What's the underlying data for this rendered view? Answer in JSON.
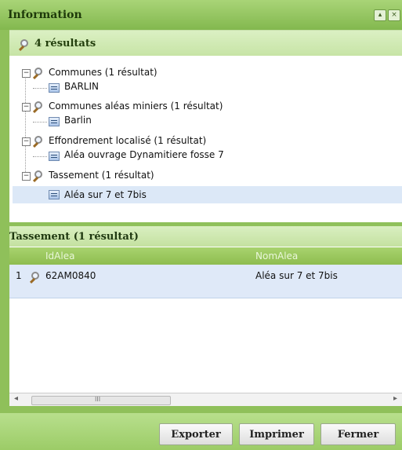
{
  "window": {
    "title": "Information",
    "controls": [
      "▴",
      "×"
    ]
  },
  "results": {
    "count_label": "4 résultats",
    "tree": [
      {
        "group": "Communes (1 résultat)",
        "item": "BARLIN"
      },
      {
        "group": "Communes aléas miniers (1 résultat)",
        "item": "Barlin"
      },
      {
        "group": "Effondrement localisé (1 résultat)",
        "item": "Aléa ouvrage Dynamitiere fosse 7"
      },
      {
        "group": "Tassement (1 résultat)",
        "item": "Aléa sur 7 et 7bis"
      }
    ]
  },
  "detail": {
    "title": "Tassement (1 résultat)",
    "columns": [
      "IdAlea",
      "NomAlea"
    ],
    "rows": [
      {
        "num": "1",
        "idalea": "62AM0840",
        "nomalea": "Aléa sur 7 et 7bis"
      }
    ],
    "scroll_text": "III"
  },
  "buttons": {
    "export": "Exporter",
    "print": "Imprimer",
    "close": "Fermer"
  }
}
